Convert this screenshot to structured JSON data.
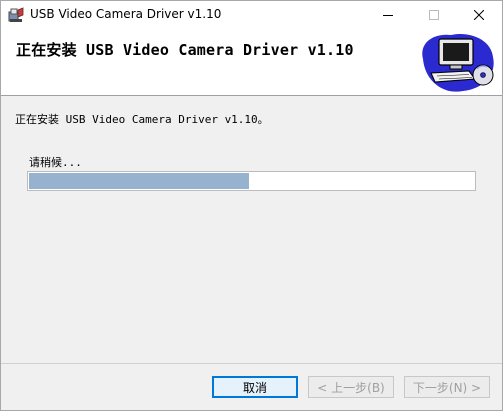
{
  "window": {
    "title": "USB Video Camera Driver v1.10"
  },
  "header": {
    "title": "正在安装 USB Video Camera Driver v1.10"
  },
  "main": {
    "status": "正在安装 USB Video Camera Driver v1.10。",
    "wait_label": "请稍候...",
    "progress_fraction": 0.495
  },
  "buttons": {
    "cancel": "取消",
    "back": "< 上一步(B)",
    "next": "下一步(N) >"
  },
  "icons": {
    "app": "installer-icon",
    "header_art": "computer-cd-icon",
    "minimize": "minimize-icon",
    "maximize": "maximize-icon",
    "close": "close-icon"
  },
  "colors": {
    "progress_fill": "#96b2cf",
    "cancel_border": "#0078d7"
  }
}
